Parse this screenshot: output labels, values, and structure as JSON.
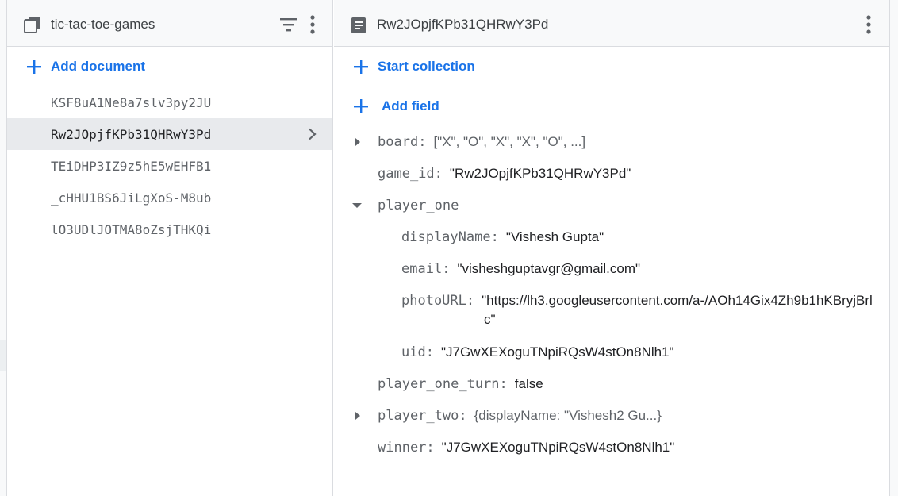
{
  "collection": {
    "title": "tic-tac-toe-games",
    "add_document_label": "Add document",
    "documents": [
      {
        "id": "KSF8uA1Ne8a7slv3py2JU"
      },
      {
        "id": "Rw2JOpjfKPb31QHRwY3Pd"
      },
      {
        "id": "TEiDHP3IZ9z5hE5wEHFB1"
      },
      {
        "id": "_cHHU1BS6JiLgXoS-M8ub"
      },
      {
        "id": "lO3UDlJOTMA8oZsjTHKQi"
      }
    ],
    "selected_index": 1
  },
  "document": {
    "title": "Rw2JOpjfKPb31QHRwY3Pd",
    "start_collection_label": "Start collection",
    "add_field_label": "Add field",
    "fields": {
      "board": {
        "key": "board",
        "value": "[\"X\", \"O\", \"X\", \"X\", \"O\", ...]"
      },
      "game_id": {
        "key": "game_id",
        "value": "\"Rw2JOpjfKPb31QHRwY3Pd\""
      },
      "player_one": {
        "key": "player_one",
        "displayName": {
          "key": "displayName",
          "value": "\"Vishesh Gupta\""
        },
        "email": {
          "key": "email",
          "value": "\"visheshguptavgr@gmail.com\""
        },
        "photoURL": {
          "key": "photoURL",
          "value": "\"https://lh3.googleusercontent.com/a-/AOh14Gix4Zh9b1hKBryjBrl",
          "value_cont": "c\""
        },
        "uid": {
          "key": "uid",
          "value": "\"J7GwXEXoguTNpiRQsW4stOn8Nlh1\""
        }
      },
      "player_one_turn": {
        "key": "player_one_turn",
        "value": "false"
      },
      "player_two": {
        "key": "player_two",
        "value": "{displayName: \"Vishesh2 Gu...}"
      },
      "winner": {
        "key": "winner",
        "value": "\"J7GwXEXoguTNpiRQsW4stOn8Nlh1\""
      }
    }
  },
  "colors": {
    "accent": "#1a73e8",
    "selected_row": "#e8eaed",
    "header_bg": "#f8f9fa"
  }
}
